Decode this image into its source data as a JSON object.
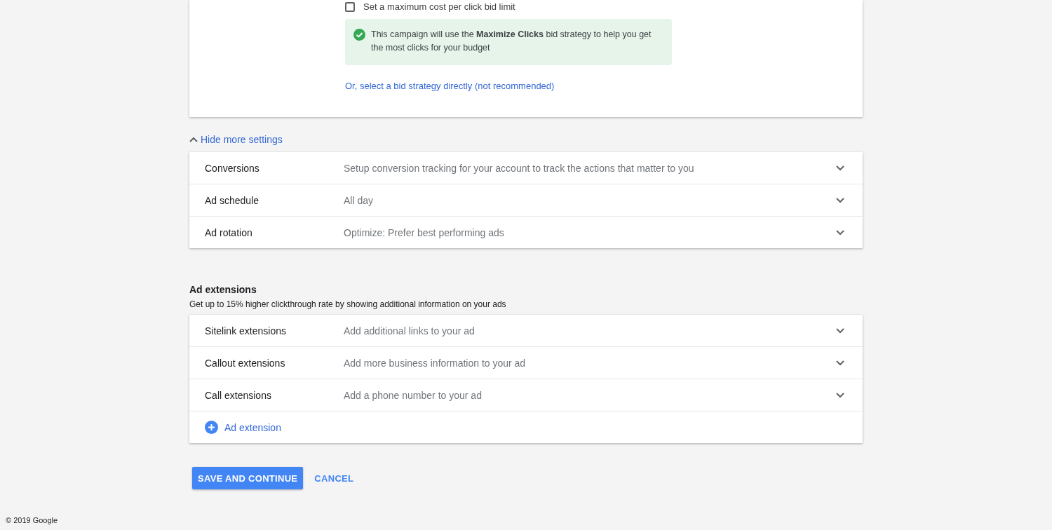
{
  "bid_card": {
    "checkbox": {
      "label": "Set a maximum cost per click bid limit",
      "checked": false
    },
    "notice": "This campaign will use the **Maximize Clicks** bid strategy to help you get the most clicks for your budget",
    "link": "Or, select a bid strategy directly (not recommended)"
  },
  "toggle": {
    "label": "Hide more settings",
    "expanded": true
  },
  "settings": [
    {
      "label": "Conversions",
      "value": "Setup conversion tracking for your account to track the actions that matter to you",
      "expanded": false
    },
    {
      "label": "Ad schedule",
      "value": "All day",
      "expanded": false
    },
    {
      "label": "Ad rotation",
      "value": "Optimize: Prefer best performing ads",
      "expanded": false
    }
  ],
  "ad_extensions": {
    "title": "Ad extensions",
    "subtitle": "Get up to 15% higher clickthrough rate by showing additional information on your ads",
    "rows": [
      {
        "label": "Sitelink extensions",
        "value": "Add additional links to your ad",
        "expanded": false
      },
      {
        "label": "Callout extensions",
        "value": "Add more business information to your ad",
        "expanded": false
      },
      {
        "label": "Call extensions",
        "value": "Add a phone number to your ad",
        "expanded": false
      }
    ],
    "add": "Ad extension"
  },
  "buttons": [
    {
      "label": "SAVE AND CONTINUE",
      "kind": "primary"
    },
    {
      "label": "CANCEL",
      "kind": "text"
    }
  ],
  "footer": "© 2019 Google"
}
